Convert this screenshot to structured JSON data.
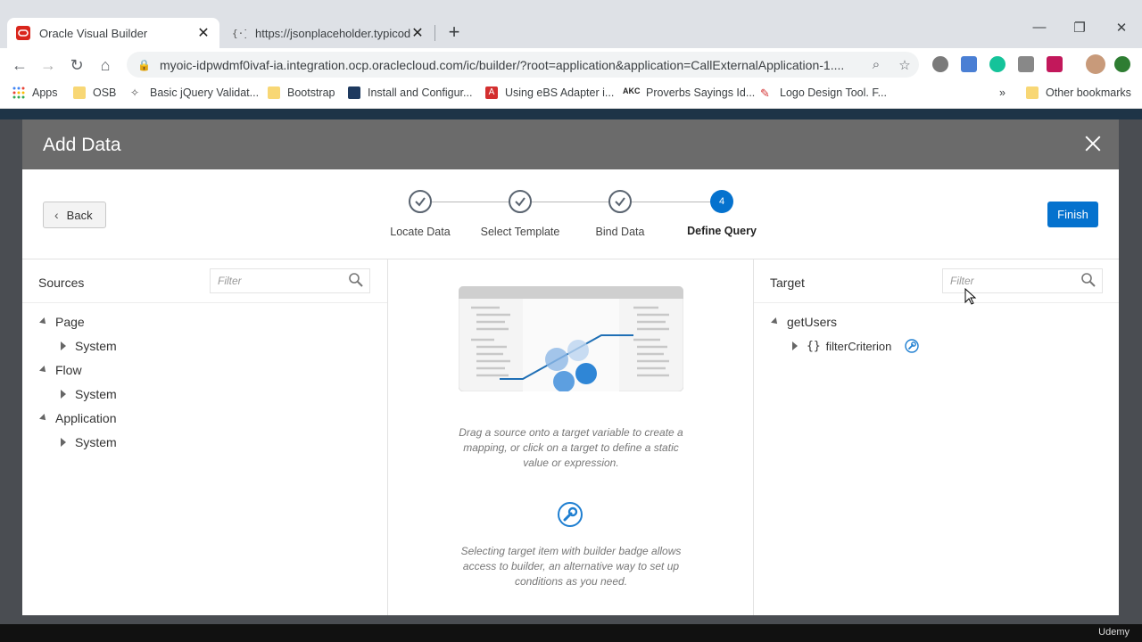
{
  "browser": {
    "tabs": [
      {
        "title": "Oracle Visual Builder"
      },
      {
        "title": "https://jsonplaceholder.typicode"
      }
    ],
    "url": "myoic-idpwdmf0ivaf-ia.integration.ocp.oraclecloud.com/ic/builder/?root=application&application=CallExternalApplication-1....",
    "bookmarks": [
      {
        "label": "Apps"
      },
      {
        "label": "OSB"
      },
      {
        "label": "Basic jQuery Validat..."
      },
      {
        "label": "Bootstrap"
      },
      {
        "label": "Install and Configur..."
      },
      {
        "label": "Using eBS Adapter i..."
      },
      {
        "label": "Proverbs Sayings Id..."
      },
      {
        "label": "Logo Design Tool. F..."
      },
      {
        "label": "Other bookmarks"
      }
    ],
    "bookmark_overflow": "»",
    "bookmark_badges": {
      "akc": "AKC",
      "ebs": "A"
    }
  },
  "dialog": {
    "title": "Add Data",
    "back_label": "Back",
    "finish_label": "Finish",
    "steps": [
      {
        "label": "Locate Data",
        "state": "done"
      },
      {
        "label": "Select Template",
        "state": "done"
      },
      {
        "label": "Bind Data",
        "state": "done"
      },
      {
        "label": "Define Query",
        "state": "current",
        "number": "4"
      }
    ],
    "sources": {
      "title": "Sources",
      "filter_placeholder": "Filter",
      "tree": [
        {
          "label": "Page",
          "children": [
            "System"
          ]
        },
        {
          "label": "Flow",
          "children": [
            "System"
          ]
        },
        {
          "label": "Application",
          "children": [
            "System"
          ]
        }
      ]
    },
    "center": {
      "help1": "Drag a source onto a target variable to create a mapping, or click on a target to define a static value or expression.",
      "help2": "Selecting target item with builder badge allows access to builder, an alternative way to set up conditions as you need."
    },
    "target": {
      "title": "Target",
      "filter_placeholder": "Filter",
      "root": "getUsers",
      "child": "filterCriterion"
    }
  },
  "watermark": "Udemy",
  "colors": {
    "accent": "#0572ce",
    "header": "#6b6b6b"
  }
}
